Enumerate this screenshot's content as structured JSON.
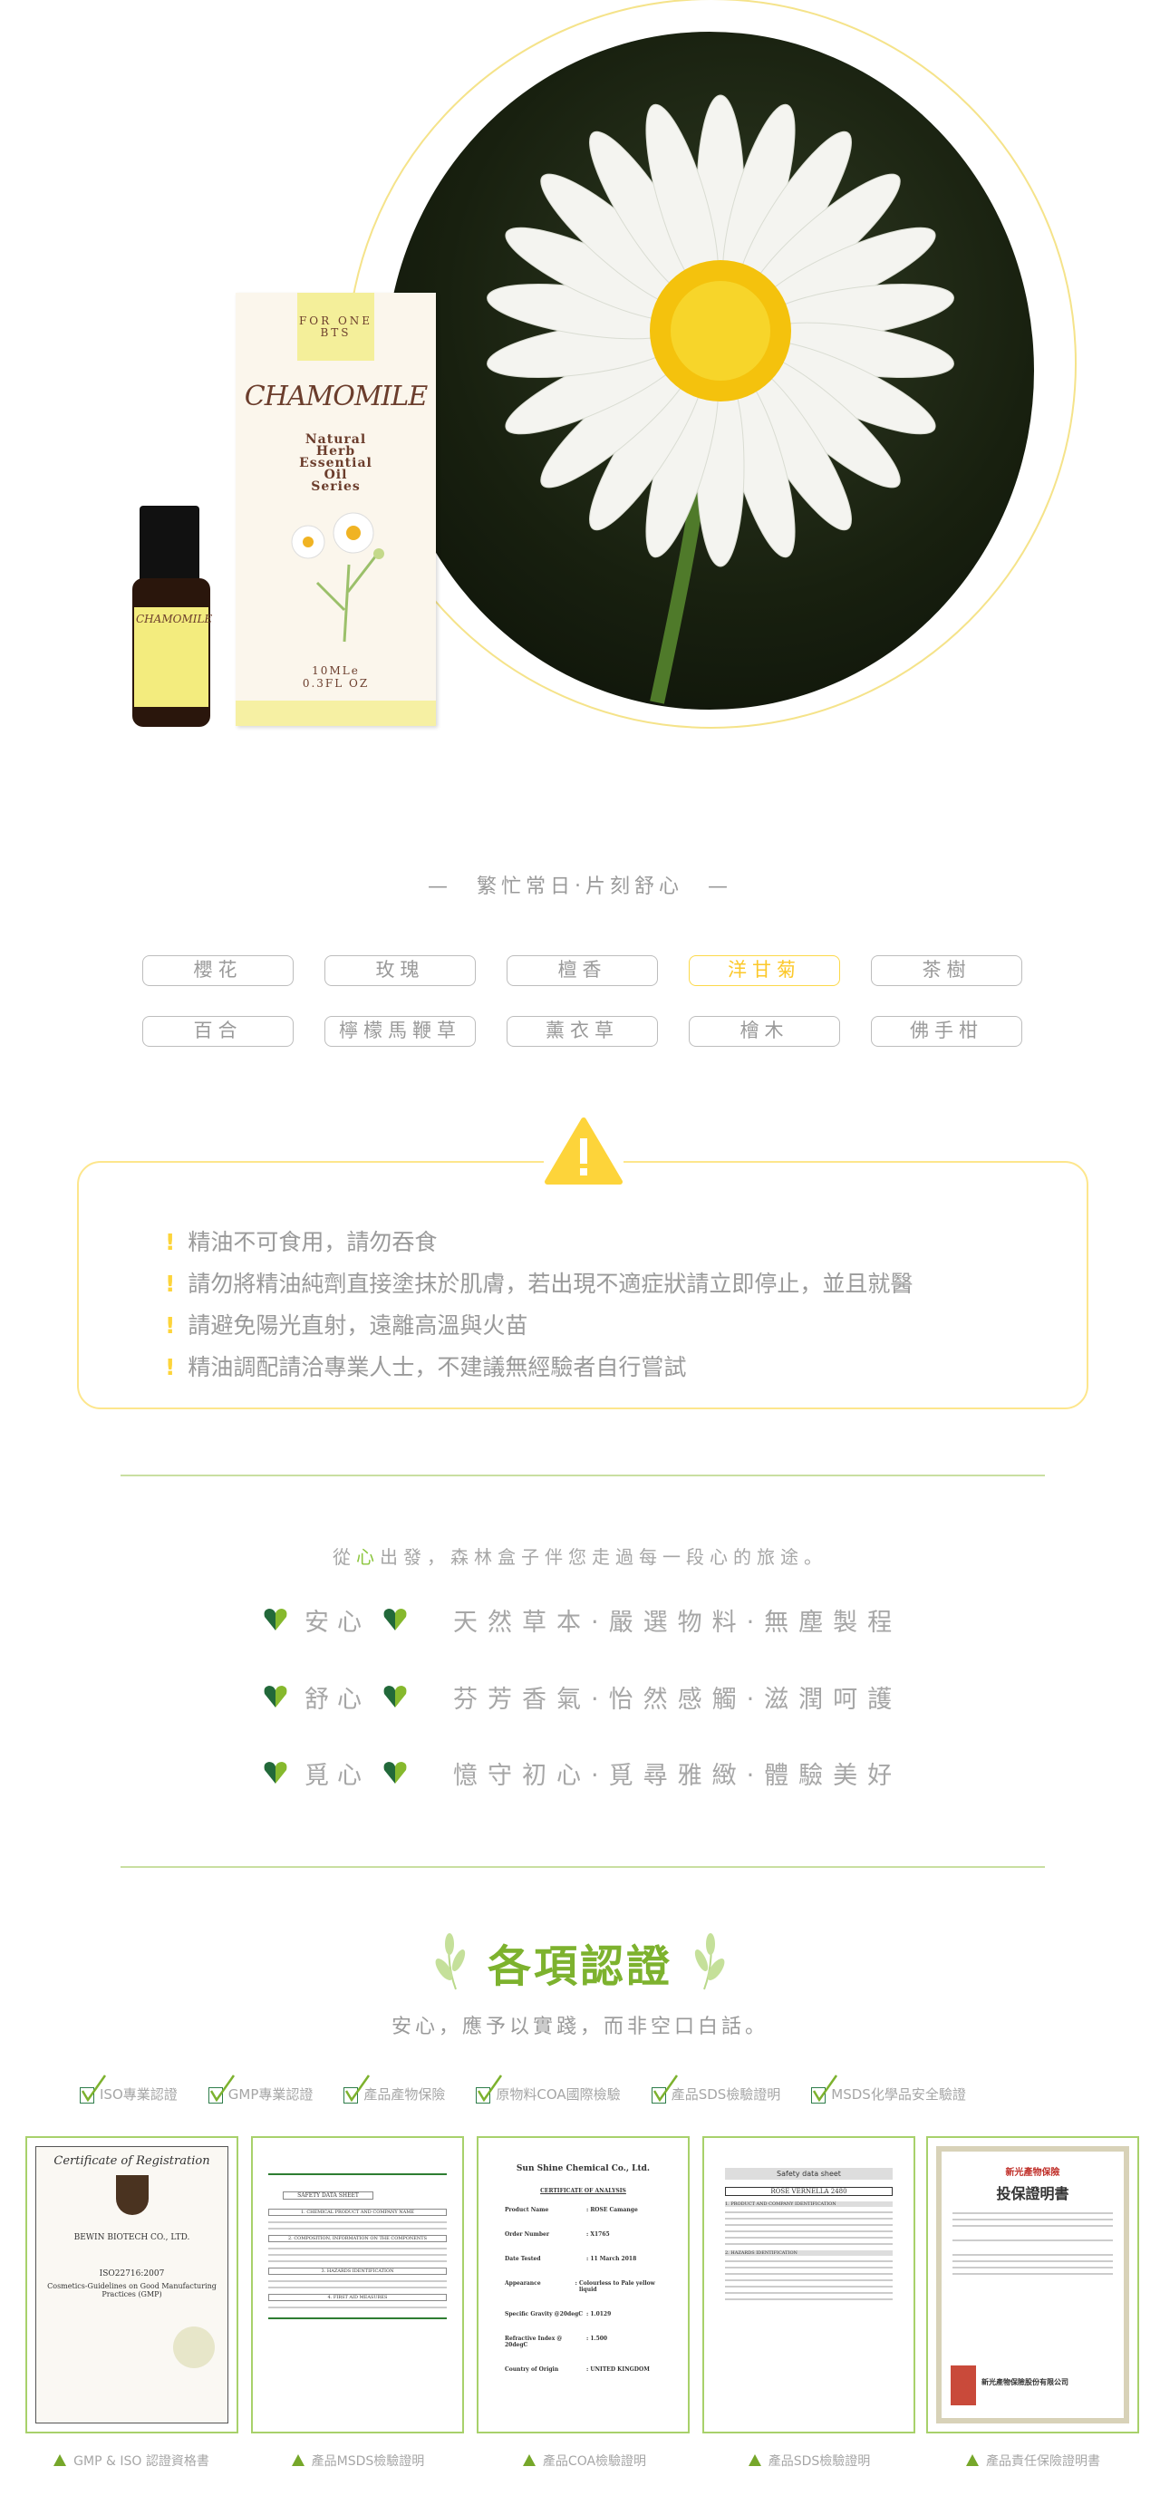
{
  "product": {
    "brand_logo": "FOR ONE BTS",
    "name": "CHAMOMILE",
    "subtitle": [
      "Natural",
      "Herb",
      "Essential",
      "Oil",
      "Series"
    ],
    "volume": "10MLe",
    "volume_oz": "0.3FL OZ",
    "bottle_label": "CHAMOMILE"
  },
  "tagline": "—　繁忙常日‧片刻舒心　—",
  "scents": [
    {
      "label": "櫻花",
      "active": false
    },
    {
      "label": "玫瑰",
      "active": false
    },
    {
      "label": "檀香",
      "active": false
    },
    {
      "label": "洋甘菊",
      "active": true
    },
    {
      "label": "茶樹",
      "active": false
    },
    {
      "label": "百合",
      "active": false
    },
    {
      "label": "檸檬馬鞭草",
      "active": false
    },
    {
      "label": "薰衣草",
      "active": false
    },
    {
      "label": "檜木",
      "active": false
    },
    {
      "label": "佛手柑",
      "active": false
    }
  ],
  "warnings": {
    "icon": "warning-triangle-icon",
    "items": [
      "精油不可食用，請勿吞食",
      "請勿將精油純劑直接塗抹於肌膚，若出現不適症狀請立即停止，並且就醫",
      "請避免陽光直射，遠離高溫與火苗",
      "精油調配請洽專業人士，不建議無經驗者自行嘗試"
    ]
  },
  "intro": {
    "prefix": "從",
    "highlight": "心",
    "suffix": "出發，森林盒子伴您走過每一段心的旅途。"
  },
  "values": [
    {
      "key": "安心",
      "phrase": "天然草本‧嚴選物料‧無塵製程"
    },
    {
      "key": "舒心",
      "phrase": "芬芳香氣‧怡然感觸‧滋潤呵護"
    },
    {
      "key": "覓心",
      "phrase": "憶守初心‧覓尋雅緻‧體驗美好"
    }
  ],
  "certifications": {
    "title": "各項認證",
    "subtitle": "安心，應予以實踐，而非空口白話。",
    "checks": [
      "ISO專業認證",
      "GMP專業認證",
      "產品產物保險",
      "原物料COA國際檢驗",
      "產品SDS檢驗證明",
      "MSDS化學品安全驗證"
    ],
    "documents": [
      {
        "caption": "GMP & ISO 認證資格書",
        "heading": "Certificate of Registration",
        "company": "BEWIN BIOTECH CO., LTD.",
        "standard": "ISO22716:2007",
        "scope": "Cosmetics-Guidelines on Good Manufacturing Practices (GMP)"
      },
      {
        "caption": "產品MSDS檢驗證明",
        "heading": "SAFETY DATA SHEET",
        "sections": [
          "1. CHEMICAL PRODUCT AND COMPANY NAME",
          "2. COMPOSITION, INFORMATION ON THE COMPONENTS",
          "3. HAZARDS IDENTIFICATION",
          "4. FIRST AID MEASURES"
        ]
      },
      {
        "caption": "產品COA檢驗證明",
        "heading": "Sun Shine Chemical Co., Ltd.",
        "doc_title": "CERTIFICATE OF ANALYSIS",
        "fields": [
          "Product Name",
          "Order Number",
          "Date Tested",
          "Appearance",
          "Specific Gravity @20degC",
          "Refractive Index @ 20degC",
          "Country of Origin"
        ],
        "field_values": [
          "ROSE Camange",
          "X1765",
          "11 March 2018",
          "Colourless to Pale yellow liquid",
          "1.0129",
          "1.500",
          "UNITED KINGDOM"
        ]
      },
      {
        "caption": "產品SDS檢驗證明",
        "heading": "Safety data sheet",
        "product": "ROSE VERNELLA 2480",
        "sections": [
          "1. PRODUCT AND COMPANY IDENTIFICATION",
          "2. HAZARDS IDENTIFICATION"
        ]
      },
      {
        "caption": "產品責任保險證明書",
        "insurer": "新光產物保險",
        "heading": "投保證明書",
        "issuer": "新光產物保險股份有限公司"
      }
    ]
  },
  "colors": {
    "accent_green": "#7db22e",
    "warning_yellow": "#fdd43a",
    "active_tag": "#fcc82a"
  }
}
